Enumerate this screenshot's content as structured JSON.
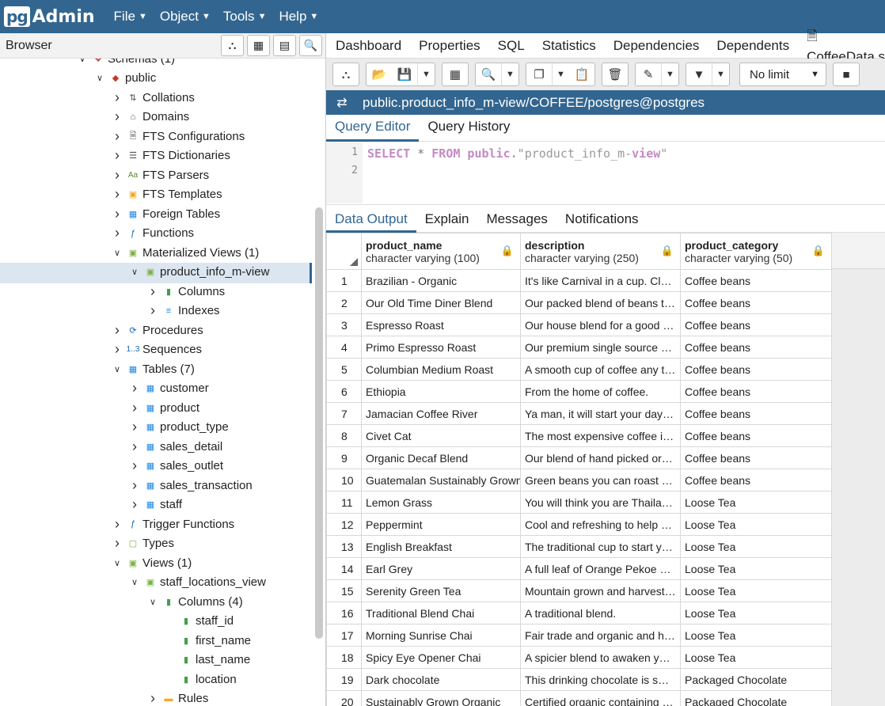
{
  "navbar": {
    "logo_pg": "pg",
    "logo_admin": "Admin",
    "menu": [
      {
        "label": "File"
      },
      {
        "label": "Object"
      },
      {
        "label": "Tools"
      },
      {
        "label": "Help"
      }
    ]
  },
  "browser": {
    "title": "Browser",
    "tree": [
      {
        "label": "Schemas (1)",
        "icon": "schemas-icon"
      },
      {
        "label": "public",
        "icon": "schema-icon"
      },
      {
        "label": "Collations",
        "icon": "collation-icon"
      },
      {
        "label": "Domains",
        "icon": "domain-icon"
      },
      {
        "label": "FTS Configurations",
        "icon": "fts-config-icon"
      },
      {
        "label": "FTS Dictionaries",
        "icon": "fts-dictionary-icon"
      },
      {
        "label": "FTS Parsers",
        "icon": "fts-parser-icon",
        "glyph": "Aa"
      },
      {
        "label": "FTS Templates",
        "icon": "fts-template-icon"
      },
      {
        "label": "Foreign Tables",
        "icon": "foreign-table-icon"
      },
      {
        "label": "Functions",
        "icon": "function-icon"
      },
      {
        "label": "Materialized Views (1)",
        "icon": "materialized-view-icon"
      },
      {
        "label": "product_info_m-view",
        "icon": "materialized-view-icon"
      },
      {
        "label": "Columns",
        "icon": "columns-icon"
      },
      {
        "label": "Indexes",
        "icon": "indexes-icon"
      },
      {
        "label": "Procedures",
        "icon": "procedure-icon"
      },
      {
        "label": "Sequences",
        "icon": "sequence-icon",
        "glyph": "1..3"
      },
      {
        "label": "Tables (7)",
        "icon": "tables-icon"
      },
      {
        "label": "customer",
        "icon": "table-icon"
      },
      {
        "label": "product",
        "icon": "table-icon"
      },
      {
        "label": "product_type",
        "icon": "table-icon"
      },
      {
        "label": "sales_detail",
        "icon": "table-icon"
      },
      {
        "label": "sales_outlet",
        "icon": "table-icon"
      },
      {
        "label": "sales_transaction",
        "icon": "table-icon"
      },
      {
        "label": "staff",
        "icon": "table-icon"
      },
      {
        "label": "Trigger Functions",
        "icon": "trigger-function-icon"
      },
      {
        "label": "Types",
        "icon": "type-icon"
      },
      {
        "label": "Views (1)",
        "icon": "views-icon"
      },
      {
        "label": "staff_locations_view",
        "icon": "view-icon"
      },
      {
        "label": "Columns (4)",
        "icon": "columns-icon"
      },
      {
        "label": "staff_id",
        "icon": "column-icon"
      },
      {
        "label": "first_name",
        "icon": "column-icon"
      },
      {
        "label": "last_name",
        "icon": "column-icon"
      },
      {
        "label": "location",
        "icon": "column-icon"
      },
      {
        "label": "Rules",
        "icon": "rules-icon"
      }
    ]
  },
  "main_tabs": [
    "Dashboard",
    "Properties",
    "SQL",
    "Statistics",
    "Dependencies",
    "Dependents",
    "CoffeeData.sql"
  ],
  "toolbar": {
    "limit": "No limit"
  },
  "connection": "public.product_info_m-view/COFFEE/postgres@postgres",
  "editor_tabs": [
    "Query Editor",
    "Query History"
  ],
  "editor": {
    "line_numbers": [
      "1",
      "2"
    ],
    "kw_select": "SELECT",
    "star": " * ",
    "kw_from": "FROM",
    "schema": " public.",
    "quote_open": "\"",
    "ident_part1": "product_info_m-",
    "kw_view": "view",
    "quote_close": "\""
  },
  "output_tabs": [
    "Data Output",
    "Explain",
    "Messages",
    "Notifications"
  ],
  "grid": {
    "columns": [
      {
        "name": "product_name",
        "type": "character varying (100)"
      },
      {
        "name": "description",
        "type": "character varying (250)"
      },
      {
        "name": "product_category",
        "type": "character varying (50)"
      }
    ],
    "rows": [
      {
        "n": "1",
        "name": "Brazilian - Organic",
        "desc": "It's like Carnival in a cup. Clea...",
        "cat": "Coffee beans"
      },
      {
        "n": "2",
        "name": "Our Old Time Diner Blend",
        "desc": "Our packed blend of beans th...",
        "cat": "Coffee beans"
      },
      {
        "n": "3",
        "name": "Espresso Roast",
        "desc": "Our house blend for a good es...",
        "cat": "Coffee beans"
      },
      {
        "n": "4",
        "name": "Primo Espresso Roast",
        "desc": "Our premium single source of ...",
        "cat": "Coffee beans"
      },
      {
        "n": "5",
        "name": "Columbian Medium Roast",
        "desc": "A smooth cup of coffee any ti...",
        "cat": "Coffee beans"
      },
      {
        "n": "6",
        "name": "Ethiopia",
        "desc": "From the home of coffee.",
        "cat": "Coffee beans"
      },
      {
        "n": "7",
        "name": "Jamacian Coffee River",
        "desc": "Ya man, it will start your day o...",
        "cat": "Coffee beans"
      },
      {
        "n": "8",
        "name": "Civet Cat",
        "desc": "The most expensive coffee in ...",
        "cat": "Coffee beans"
      },
      {
        "n": "9",
        "name": "Organic Decaf Blend",
        "desc": "Our blend of hand picked orga...",
        "cat": "Coffee beans"
      },
      {
        "n": "10",
        "name": "Guatemalan Sustainably Grown",
        "desc": "Green beans you can roast yo...",
        "cat": "Coffee beans"
      },
      {
        "n": "11",
        "name": "Lemon Grass",
        "desc": "You will think you are Thailand...",
        "cat": "Loose Tea"
      },
      {
        "n": "12",
        "name": "Peppermint",
        "desc": "Cool and refreshing to help ca...",
        "cat": "Loose Tea"
      },
      {
        "n": "13",
        "name": "English Breakfast",
        "desc": "The traditional cup to start yo...",
        "cat": "Loose Tea"
      },
      {
        "n": "14",
        "name": "Earl Grey",
        "desc": "A full leaf of Orange Pekoe ble...",
        "cat": "Loose Tea"
      },
      {
        "n": "15",
        "name": "Serenity Green Tea",
        "desc": "Mountain grown and harveste...",
        "cat": "Loose Tea"
      },
      {
        "n": "16",
        "name": "Traditional Blend Chai",
        "desc": "A traditional blend.",
        "cat": "Loose Tea"
      },
      {
        "n": "17",
        "name": "Morning Sunrise Chai",
        "desc": "Fair trade and organic and ha...",
        "cat": "Loose Tea"
      },
      {
        "n": "18",
        "name": "Spicy Eye Opener Chai",
        "desc": "A spicier blend to awaken you...",
        "cat": "Loose Tea"
      },
      {
        "n": "19",
        "name": "Dark chocolate",
        "desc": "This drinking chocolate is sm...",
        "cat": "Packaged Chocolate"
      },
      {
        "n": "20",
        "name": "Sustainably Grown Organic",
        "desc": "Certified organic containing th...",
        "cat": "Packaged Chocolate"
      }
    ]
  },
  "colors": {
    "brand": "#326690",
    "selection": "#dbe6f0"
  }
}
